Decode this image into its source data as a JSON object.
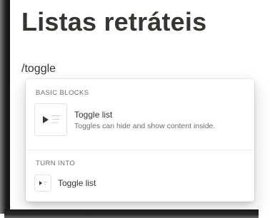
{
  "page": {
    "title": "Listas retráteis",
    "command_input": "/toggle"
  },
  "menu": {
    "sections": [
      {
        "label": "BASIC BLOCKS",
        "items": [
          {
            "name": "Toggle list",
            "description": "Toggles can hide and show content inside.",
            "icon": "toggle-list-icon"
          }
        ]
      },
      {
        "label": "TURN INTO",
        "items": [
          {
            "name": "Toggle list",
            "icon": "toggle-list-icon"
          }
        ]
      }
    ]
  },
  "colors": {
    "text": "#37352f",
    "muted": "#6f6e69",
    "border": "#e3e2df"
  }
}
